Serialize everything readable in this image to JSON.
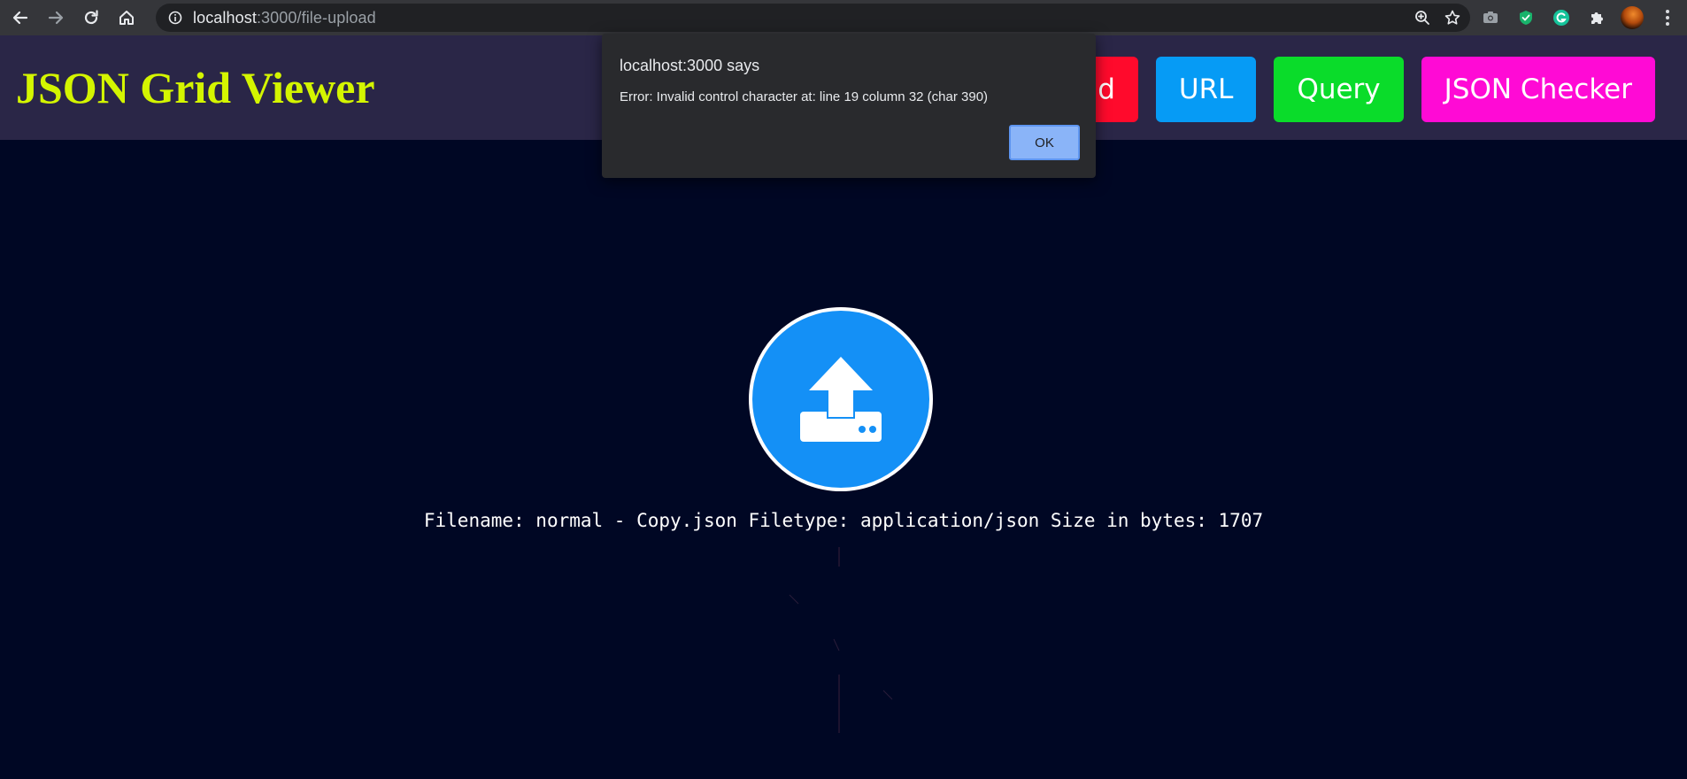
{
  "browser": {
    "url_host": "localhost",
    "url_path": ":3000/file-upload",
    "icons": [
      "back-icon",
      "forward-icon",
      "reload-icon",
      "home-icon",
      "site-info-icon",
      "zoom-icon",
      "bookmark-star-icon",
      "camera-extension-icon",
      "shield-extension-icon",
      "grammarly-extension-icon",
      "extensions-puzzle-icon",
      "profile-avatar",
      "menu-kebab-icon"
    ]
  },
  "header": {
    "title": "JSON Grid Viewer",
    "nav": [
      {
        "label": "Upload",
        "color": "#ff0a2c"
      },
      {
        "label": "URL",
        "color": "#069bf5"
      },
      {
        "label": "Query",
        "color": "#0adc2a"
      },
      {
        "label": "JSON Checker",
        "color": "#ff0ad5"
      }
    ]
  },
  "upload": {
    "icon": "upload-tray-icon",
    "file_info": "Filename: normal - Copy.json Filetype: application/json Size in bytes: 1707"
  },
  "dialog": {
    "title": "localhost:3000 says",
    "message": "Error: Invalid control character at: line 19 column 32 (char 390)",
    "ok_label": "OK"
  },
  "colors": {
    "page_bg": "#000724",
    "header_bg": "#2a2647",
    "title": "#d4f500",
    "upload_circle": "#1490f6"
  }
}
